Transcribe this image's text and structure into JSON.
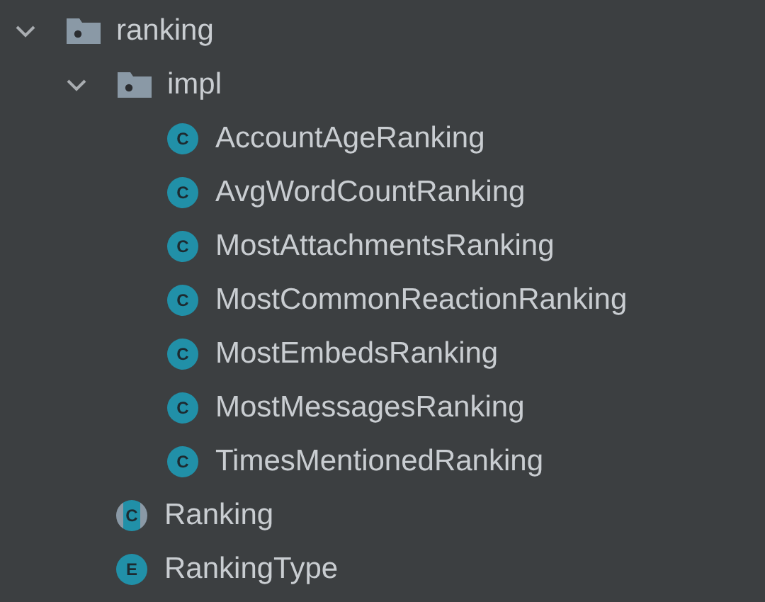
{
  "tree": [
    {
      "kind": "folder",
      "label": "ranking",
      "expanded": true,
      "children": [
        {
          "kind": "folder",
          "label": "impl",
          "expanded": true,
          "children": [
            {
              "kind": "class",
              "badge": "C",
              "label": "AccountAgeRanking"
            },
            {
              "kind": "class",
              "badge": "C",
              "label": "AvgWordCountRanking"
            },
            {
              "kind": "class",
              "badge": "C",
              "label": "MostAttachmentsRanking"
            },
            {
              "kind": "class",
              "badge": "C",
              "label": "MostCommonReactionRanking"
            },
            {
              "kind": "class",
              "badge": "C",
              "label": "MostEmbedsRanking"
            },
            {
              "kind": "class",
              "badge": "C",
              "label": "MostMessagesRanking"
            },
            {
              "kind": "class",
              "badge": "C",
              "label": "TimesMentionedRanking"
            }
          ]
        },
        {
          "kind": "abstract_class",
          "badge": "C",
          "label": "Ranking"
        },
        {
          "kind": "enum",
          "badge": "E",
          "label": "RankingType"
        }
      ]
    }
  ]
}
